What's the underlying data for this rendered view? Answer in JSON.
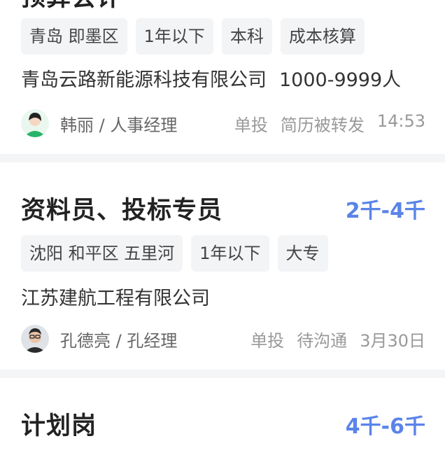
{
  "jobs": [
    {
      "title": "预算会计",
      "salary": "",
      "tags": [
        "青岛 即墨区",
        "1年以下",
        "本科",
        "成本核算"
      ],
      "company": "青岛云路新能源科技有限公司",
      "company_size": "1000-9999人",
      "recruiter": "韩丽 / 人事经理",
      "delivery": "单投",
      "status": "简历被转发",
      "time": "14:53"
    },
    {
      "title": "资料员、投标专员",
      "salary": "2千-4千",
      "tags": [
        "沈阳 和平区 五里河",
        "1年以下",
        "大专"
      ],
      "company": "江苏建航工程有限公司",
      "company_size": "",
      "recruiter": "孔德亮 / 孔经理",
      "delivery": "单投",
      "status": "待沟通",
      "time": "3月30日"
    },
    {
      "title": "计划岗",
      "salary": "4千-6千"
    }
  ],
  "colors": {
    "salary": "#5a84e8",
    "background": "#f4f5f7"
  }
}
